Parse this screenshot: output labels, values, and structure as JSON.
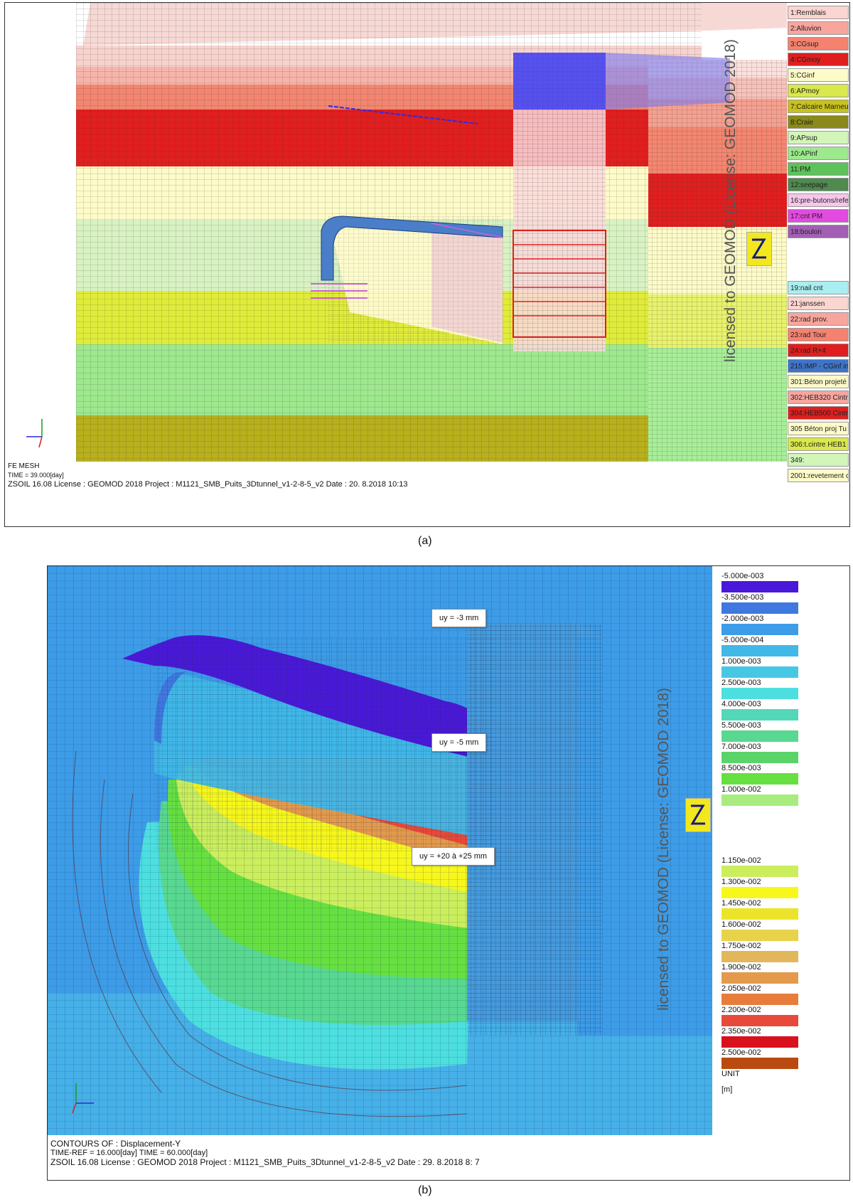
{
  "panel_a": {
    "legend": [
      {
        "label": "1:Remblais",
        "color": "#fbd5d0"
      },
      {
        "label": "2:Alluvion",
        "color": "#f7a59d"
      },
      {
        "label": "3:CGsup",
        "color": "#f4826f"
      },
      {
        "label": "4:CGmoy",
        "color": "#e01e1e"
      },
      {
        "label": "5:CGinf",
        "color": "#fdfbc8"
      },
      {
        "label": "6:APmoy",
        "color": "#d9e84a"
      },
      {
        "label": "7:Calcaire Marneu",
        "color": "#c8c21c"
      },
      {
        "label": "8:Craie",
        "color": "#8a8a1a"
      },
      {
        "label": "9:APsup",
        "color": "#d2f5b8"
      },
      {
        "label": "10:APinf",
        "color": "#9ee88e"
      },
      {
        "label": "11:PM",
        "color": "#5cc25a"
      },
      {
        "label": "12:seepage",
        "color": "#4f8a4f"
      },
      {
        "label": "16:pre-butons/refe",
        "color": "#f5c7ea"
      },
      {
        "label": "17:cnt PM",
        "color": "#e24be0"
      },
      {
        "label": "18:boulon",
        "color": "#a35fb5"
      },
      {
        "label": "19:nail cnt",
        "color": "#a9eef0"
      },
      {
        "label": "21:janssen",
        "color": "#fbd5d0"
      },
      {
        "label": "22:rad prov.",
        "color": "#f7a59d"
      },
      {
        "label": "23:rad Tour",
        "color": "#f4826f"
      },
      {
        "label": "24:rad R+4",
        "color": "#e01e1e"
      },
      {
        "label": "215:IMP - CGinf in",
        "color": "#3f74c8"
      },
      {
        "label": "301:Béton projeté",
        "color": "#fdfbc8"
      },
      {
        "label": "302:HEB320 Cintr",
        "color": "#f7a59d"
      },
      {
        "label": "304:HEB500 Cintr",
        "color": "#e01e1e"
      },
      {
        "label": "305 Béton proj Tu",
        "color": "#fdfbc8"
      },
      {
        "label": "306:t.cintre HEB1",
        "color": "#d9e84a"
      },
      {
        "label": "349:",
        "color": "#d2f5b8"
      },
      {
        "label": "2001:revetement c",
        "color": "#fdfbc8"
      }
    ],
    "watermark": "licensed to GEOMOD (License: GEOMOD 2018)",
    "footer_title": "FE MESH",
    "footer_time": "TIME = 39.000[day]",
    "footer_info": "ZSOIL 16.08   License :  GEOMOD 2018   Project : M1121_SMB_Puits_3Dtunnel_v1-2-8-5_v2     Date : 20. 8.2018  10:13",
    "caption": "(a)"
  },
  "panel_b": {
    "colorbar": [
      {
        "label": "-5.000e-003",
        "color": "#4a18d8"
      },
      {
        "label": "-3.500e-003",
        "color": "#3f78e0"
      },
      {
        "label": "-2.000e-003",
        "color": "#3d9ce8"
      },
      {
        "label": "-5.000e-004",
        "color": "#40b8e8"
      },
      {
        "label": "1.000e-003",
        "color": "#46c8e4"
      },
      {
        "label": "2.500e-003",
        "color": "#4ddfe0"
      },
      {
        "label": "4.000e-003",
        "color": "#52d8b8"
      },
      {
        "label": "5.500e-003",
        "color": "#58d890"
      },
      {
        "label": "7.000e-003",
        "color": "#5ad468"
      },
      {
        "label": "8.500e-003",
        "color": "#66e040"
      },
      {
        "label": "1.000e-002",
        "color": "#a8ec80"
      },
      {
        "label": "1.150e-002",
        "color": "#cbee5c"
      },
      {
        "label": "1.300e-002",
        "color": "#f7f71c"
      },
      {
        "label": "1.450e-002",
        "color": "#ece42a"
      },
      {
        "label": "1.600e-002",
        "color": "#e8d24a"
      },
      {
        "label": "1.750e-002",
        "color": "#e2b65a"
      },
      {
        "label": "1.900e-002",
        "color": "#e39a4c"
      },
      {
        "label": "2.050e-002",
        "color": "#e77d3a"
      },
      {
        "label": "2.200e-002",
        "color": "#e74a3a"
      },
      {
        "label": "2.350e-002",
        "color": "#d8121c"
      },
      {
        "label": "2.500e-002",
        "color": "#b94a10"
      }
    ],
    "unit_title": "UNIT",
    "unit_value": "[m]",
    "watermark": "licensed to GEOMOD (License: GEOMOD 2018)",
    "callouts": {
      "top": "uy = -3 mm",
      "mid": "uy = -5 mm",
      "low": "uy = +20 à +25 mm"
    },
    "footer_title": "CONTOURS OF : Displacement-Y",
    "footer_time": "TIME-REF = 16.000[day]   TIME = 60.000[day]",
    "footer_info": "ZSOIL 16.08   License :  GEOMOD 2018   Project : M1121_SMB_Puits_3Dtunnel_v1-2-8-5_v2     Date : 29. 8.2018   8: 7",
    "caption": "(b)"
  }
}
